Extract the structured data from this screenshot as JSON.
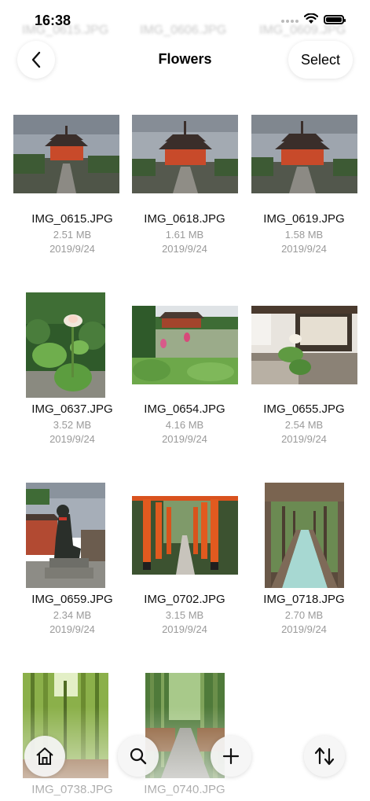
{
  "status_bar": {
    "time": "16:38"
  },
  "background_row": {
    "items": [
      "IMG_0615.JPG",
      "IMG_0606.JPG",
      "IMG_0609.JPG"
    ]
  },
  "nav": {
    "title": "Flowers",
    "select_label": "Select"
  },
  "photos": [
    {
      "name": "IMG_0615.JPG",
      "size": "2.51 MB",
      "date": "2019/9/24"
    },
    {
      "name": "IMG_0618.JPG",
      "size": "1.61 MB",
      "date": "2019/9/24"
    },
    {
      "name": "IMG_0619.JPG",
      "size": "1.58 MB",
      "date": "2019/9/24"
    },
    {
      "name": "IMG_0637.JPG",
      "size": "3.52 MB",
      "date": "2019/9/24"
    },
    {
      "name": "IMG_0654.JPG",
      "size": "4.16 MB",
      "date": "2019/9/24"
    },
    {
      "name": "IMG_0655.JPG",
      "size": "2.54 MB",
      "date": "2019/9/24"
    },
    {
      "name": "IMG_0659.JPG",
      "size": "2.34 MB",
      "date": "2019/9/24"
    },
    {
      "name": "IMG_0702.JPG",
      "size": "3.15 MB",
      "date": "2019/9/24"
    },
    {
      "name": "IMG_0718.JPG",
      "size": "2.70 MB",
      "date": "2019/9/24"
    },
    {
      "name": "IMG_0738.JPG"
    },
    {
      "name": "IMG_0740.JPG"
    }
  ],
  "toolbar": {
    "icons": [
      "home-icon",
      "search-icon",
      "plus-icon",
      "sort-icon"
    ]
  }
}
